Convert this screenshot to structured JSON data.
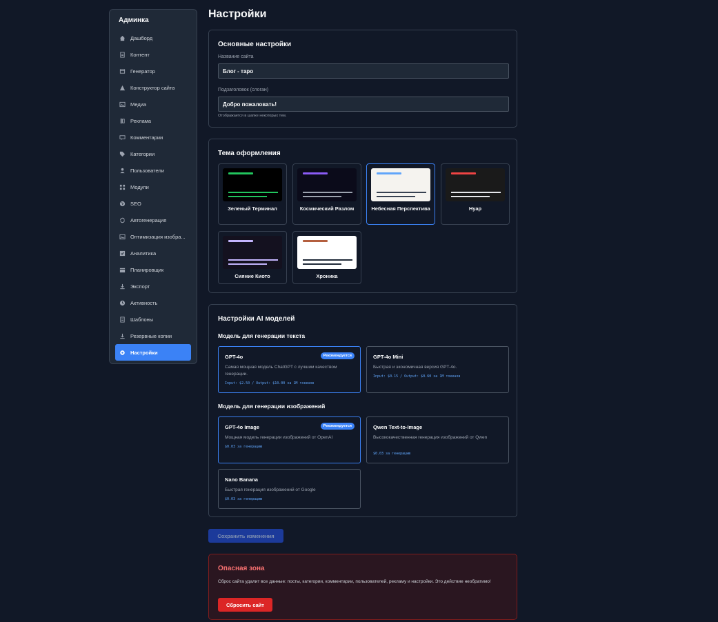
{
  "sidebar": {
    "title": "Админка",
    "items": [
      {
        "label": "Дашборд",
        "icon": "home-icon"
      },
      {
        "label": "Контент",
        "icon": "document-icon"
      },
      {
        "label": "Генератор",
        "icon": "generator-icon"
      },
      {
        "label": "Конструктор сайта",
        "icon": "builder-icon"
      },
      {
        "label": "Медиа",
        "icon": "image-icon"
      },
      {
        "label": "Реклама",
        "icon": "ads-icon"
      },
      {
        "label": "Комментарии",
        "icon": "comment-icon"
      },
      {
        "label": "Категории",
        "icon": "tag-icon"
      },
      {
        "label": "Пользователи",
        "icon": "user-icon"
      },
      {
        "label": "Модули",
        "icon": "grid-icon"
      },
      {
        "label": "SEO",
        "icon": "globe-icon"
      },
      {
        "label": "Автогенерация",
        "icon": "refresh-icon"
      },
      {
        "label": "Оптимизация изобра...",
        "icon": "image-icon"
      },
      {
        "label": "Аналитика",
        "icon": "chart-icon"
      },
      {
        "label": "Планировщик",
        "icon": "calendar-icon"
      },
      {
        "label": "Экспорт",
        "icon": "download-icon"
      },
      {
        "label": "Активность",
        "icon": "clock-icon"
      },
      {
        "label": "Шаблоны",
        "icon": "document-icon"
      },
      {
        "label": "Резервные копии",
        "icon": "download-icon"
      },
      {
        "label": "Настройки",
        "icon": "gear-icon",
        "active": true
      }
    ]
  },
  "page": {
    "title": "Настройки"
  },
  "basic": {
    "title": "Основные настройки",
    "site_name_label": "Название сайта",
    "site_name_value": "Блог - таро",
    "tagline_label": "Подзаголовок (слоган)",
    "tagline_value": "Добро пожаловать!",
    "tagline_hint": "Отображается в шапке некоторых тем."
  },
  "theme": {
    "title": "Тема оформления",
    "options": [
      {
        "name": "Зеленый Терминал",
        "bg": "#000000",
        "accent": "#22c55e",
        "line": "#22c55e"
      },
      {
        "name": "Космический Разлом",
        "bg": "#0b0b1a",
        "accent": "#8b5cf6",
        "line": "#9ca3af"
      },
      {
        "name": "Небесная Перспектива",
        "bg": "#f5f3ef",
        "accent": "#60a5fa",
        "line": "#374151",
        "selected": true
      },
      {
        "name": "Нуар",
        "bg": "#1a1a1a",
        "accent": "#ef4444",
        "line": "#e5e7eb"
      },
      {
        "name": "Сияние Киото",
        "bg": "#14111f",
        "accent": "#c4b5fd",
        "line": "#c4b5fd"
      },
      {
        "name": "Хроника",
        "bg": "#ffffff",
        "accent": "#b45f3f",
        "line": "#1f2937"
      }
    ]
  },
  "ai": {
    "title": "Настройки AI моделей",
    "text_section": "Модель для генерации текста",
    "image_section": "Модель для генерации изображений",
    "badge": "Рекомендуется",
    "text_models": [
      {
        "name": "GPT-4o",
        "desc": "Самая мощная модель ChatGPT с лучшим качеством генерации.",
        "price": "Input: $2.50 / Output: $10.00 за 1M токенов",
        "selected": true
      },
      {
        "name": "GPT-4o Mini",
        "desc": "Быстрая и экономичная версия GPT-4o.",
        "price": "Input: $0.15 / Output: $0.60 за 1M токенов"
      }
    ],
    "image_models": [
      {
        "name": "GPT-4o Image",
        "desc": "Мощная модель генерации изображений от OpenAI",
        "price": "$0.03 за генерацию",
        "selected": true
      },
      {
        "name": "Qwen Text-to-Image",
        "desc": "Высококачественная генерация изображений от Qwen",
        "price": "$0.03 за генерацию"
      },
      {
        "name": "Nano Banana",
        "desc": "Быстрая генерация изображений от Google",
        "price": "$0.03 за генерацию"
      }
    ]
  },
  "actions": {
    "save_label": "Сохранить изменения"
  },
  "danger": {
    "title": "Опасная зона",
    "text": "Сброс сайта удалит все данные: посты, категории, комментарии, пользователей, рекламу и настройки. Это действие необратимо!",
    "reset_label": "Сбросить сайт"
  }
}
